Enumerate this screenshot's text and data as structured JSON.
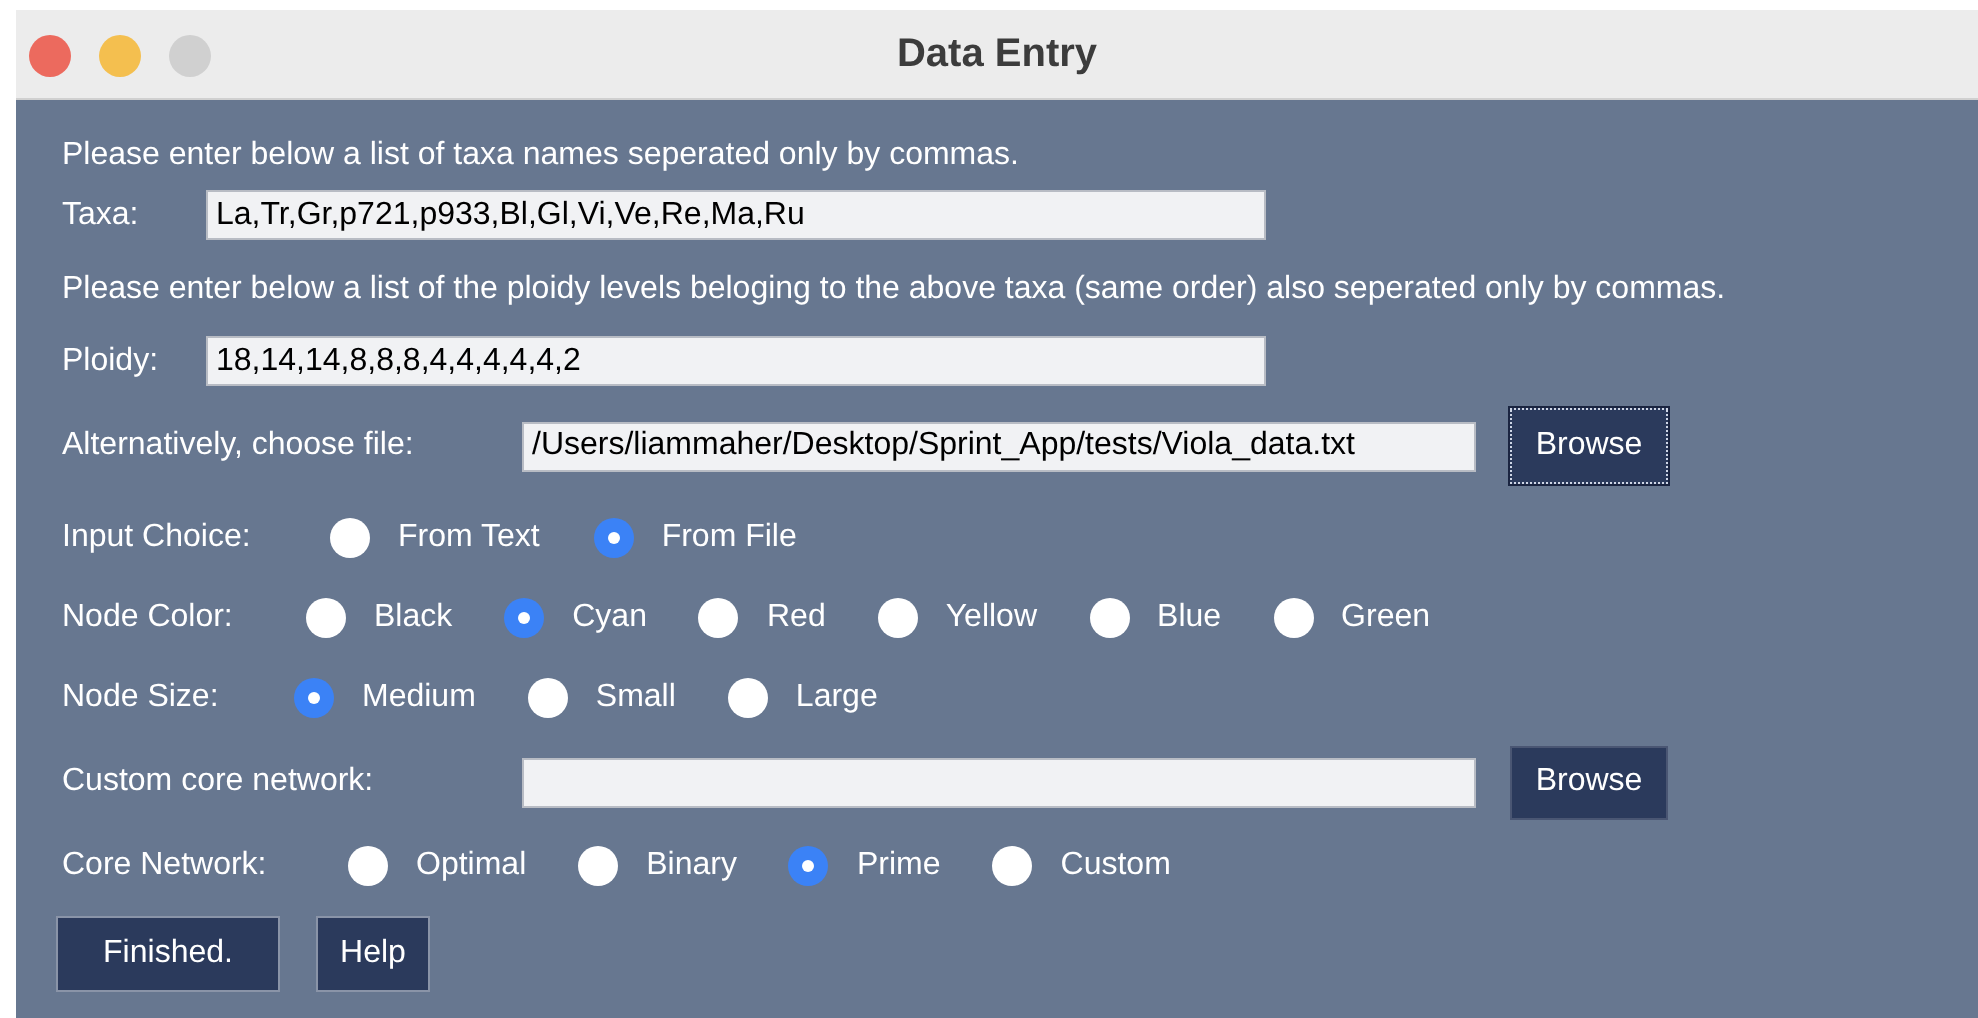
{
  "window": {
    "title": "Data Entry"
  },
  "instructions_taxa": "Please enter below a list of taxa names seperated only by commas.",
  "taxa": {
    "label": "Taxa:",
    "value": "La,Tr,Gr,p721,p933,Bl,Gl,Vi,Ve,Re,Ma,Ru"
  },
  "instructions_ploidy": "Please enter below a list of the ploidy levels beloging to the above taxa (same order) also seperated only by commas.",
  "ploidy": {
    "label": "Ploidy:",
    "value": "18,14,14,8,8,8,4,4,4,4,4,2"
  },
  "file": {
    "label": "Alternatively, choose file:",
    "value": "/Users/liammaher/Desktop/Sprint_App/tests/Viola_data.txt",
    "button": "Browse",
    "focused": true
  },
  "radio_groups": [
    {
      "label": "Input Choice:",
      "options": [
        {
          "label": "From Text",
          "selected": false
        },
        {
          "label": "From File",
          "selected": true
        }
      ]
    },
    {
      "label": "Node Color:",
      "options": [
        {
          "label": "Black",
          "selected": false
        },
        {
          "label": "Cyan",
          "selected": true
        },
        {
          "label": "Red",
          "selected": false
        },
        {
          "label": "Yellow",
          "selected": false
        },
        {
          "label": "Blue",
          "selected": false
        },
        {
          "label": "Green",
          "selected": false
        }
      ]
    },
    {
      "label": "Node Size:",
      "options": [
        {
          "label": "Medium",
          "selected": true
        },
        {
          "label": "Small",
          "selected": false
        },
        {
          "label": "Large",
          "selected": false
        }
      ]
    }
  ],
  "custom_core": {
    "label": "Custom core network:",
    "button": "Browse",
    "focused": false
  },
  "core_network": {
    "label": "Core Network:",
    "options": [
      {
        "label": "Optimal",
        "selected": false
      },
      {
        "label": "Binary",
        "selected": false
      },
      {
        "label": "Prime",
        "selected": true
      },
      {
        "label": "Custom",
        "selected": false
      }
    ]
  },
  "buttons": [
    "Finished.",
    "Help"
  ]
}
